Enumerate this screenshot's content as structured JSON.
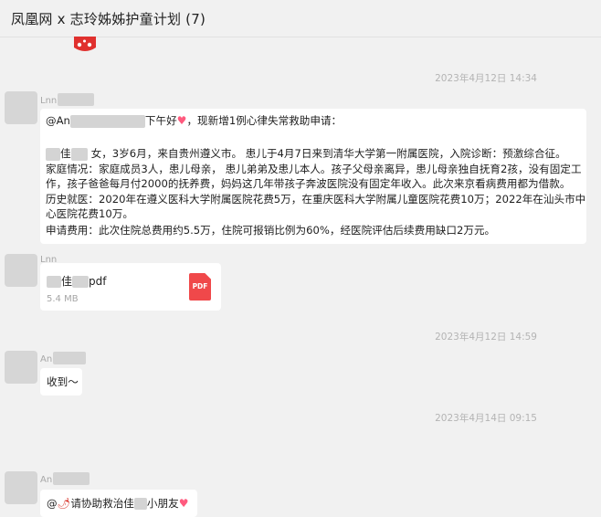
{
  "window": {
    "title": "凤凰网 x 志玲姊姊护童计划 (7)"
  },
  "messages": [
    {
      "timestamp": "2023年4月12日 14:34",
      "sender_prefix": "Lnn",
      "lines": {
        "l1_mention": "@An",
        "l1_suffix": "下午好",
        "l1_rest": "，现新增1例心律失常救助申请：",
        "l2_name": "佳",
        "l2_rest": "女，3岁6月，来自贵州遵义市。 患儿于4月7日来到清华大学第一附属医院，入院诊断：预激综合征。",
        "l3": "家庭情况：家庭成员3人，患儿母亲， 患儿弟弟及患儿本人。孩子父母亲离异，患儿母亲独自抚育2孩，没有固定工",
        "l4": "作，孩子爸爸每月付2000的抚养费，妈妈这几年带孩子奔波医院没有固定年收入。此次来京看病费用都为借款。",
        "l5": "历史就医：2020年在遵义医科大学附属医院花费5万，在重庆医科大学附属儿童医院花费10万；2022年在汕头市中",
        "l6": "心医院花费10万。",
        "l7": "申请费用：此次住院总费用约5.5万，住院可报销比例为60%，经医院评估后续费用缺口2万元。"
      }
    },
    {
      "sender_prefix": "Lnn",
      "file": {
        "name_prefix": "佳",
        "name_suffix": "pdf",
        "size": "5.4 MB",
        "type_label": "PDF"
      }
    },
    {
      "timestamp": "2023年4月12日 14:59",
      "sender_prefix": "An",
      "text": "收到～"
    },
    {
      "timestamp": "2023年4月14日 09:15",
      "sender_prefix": "An",
      "text_prefix": "@",
      "text_mid": "请协助救治佳",
      "text_suffix": "小朋友"
    }
  ],
  "colors": {
    "background": "#f1f1f1",
    "bubble": "#ffffff",
    "timestamp": "#b4b4b4",
    "pdf_icon": "#f0484a",
    "heart": "#ff5a7e"
  }
}
